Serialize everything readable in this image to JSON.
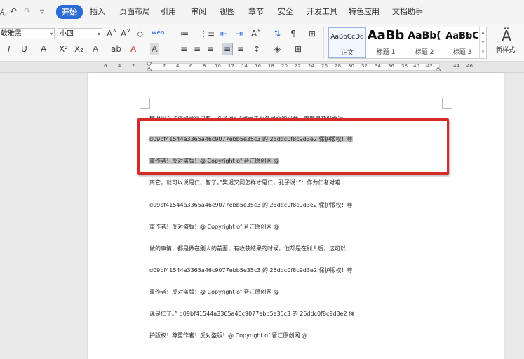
{
  "quick_access": {
    "undo": "↶",
    "redo": "↷",
    "menu": "▿",
    "left_glyph": "ん"
  },
  "tabs": [
    {
      "label": "开始",
      "active": true
    },
    {
      "label": "插入"
    },
    {
      "label": "页面布局"
    },
    {
      "label": "引用"
    },
    {
      "label": "审阅"
    },
    {
      "label": "视图"
    },
    {
      "label": "章节"
    },
    {
      "label": "安全"
    },
    {
      "label": "开发工具"
    },
    {
      "label": "特色应用"
    },
    {
      "label": "文档助手"
    }
  ],
  "font": {
    "name": "软雅黑",
    "size": "小四"
  },
  "toolbar": {
    "grow": "A˄",
    "shrink": "A˅",
    "clear": "◇",
    "phonetic": "wén",
    "italic": "I",
    "underline": "U",
    "strike": "A",
    "superscript": "X²",
    "subscript": "X₂",
    "text_effect": "A",
    "highlight": "ab",
    "font_color": "A",
    "char_shade": "A",
    "bullets": "≔",
    "numbering": "⋮≡",
    "outdent": "⇤",
    "indent": "⇥",
    "case": "Aˇ",
    "sort": "⇅",
    "marks": "¶",
    "border": "⊞",
    "align_left": "≡",
    "align_center": "≡",
    "align_right": "≡",
    "justify": "≡",
    "distribute": "≡",
    "line_spacing": "↕",
    "shading": "◈",
    "borders": "⊞"
  },
  "styles": [
    {
      "preview": "AaBbCcDd",
      "label": "正文",
      "selected": true
    },
    {
      "preview": "AaBb",
      "label": "标题 1"
    },
    {
      "preview": "AaBb(",
      "label": "标题 2"
    },
    {
      "preview": "AaBbC",
      "label": "标题 3"
    }
  ],
  "new_style": {
    "icon": "Ä",
    "label": "新样式·"
  },
  "ruler": {
    "labels_left": [
      "6",
      "4",
      "2"
    ],
    "labels_right": [
      "2",
      "4",
      "6",
      "8",
      "10",
      "12",
      "14",
      "16",
      "18",
      "20",
      "22",
      "24",
      "26",
      "28",
      "30",
      "32",
      "34",
      "36",
      "38",
      "40",
      "42",
      "44",
      "46"
    ]
  },
  "document": {
    "lines": [
      "樊迟问孔子怎样才算是智，孔子说：“致力于服务民众的义举，尊敬鬼神但要远",
      "d09bf41544a3365a46c9077ebb5e35c3 的 25ddc0f8c9d3e2  保护版权！尊",
      "重作者！反对盗版！@ Copyright of  晋江原创网  @",
      "离它，就可以说是仁、智了。”樊迟又问怎样才是仁，孔子说：”：作为仁者对难",
      "d09bf41544a3365a46c9077ebb5e35c3 的 25ddc0f8c9d3e2  保护版权！尊",
      "重作者！反对盗版！@ Copyright of  晋江原创网  @",
      "做的事情，都是做在别人的前面，有收获结果的时候，他却是在别人后，这可以",
      "d09bf41544a3365a46c9077ebb5e35c3 的 25ddc0f8c9d3e2  保护版权！尊",
      "重作者！反对盗版！@ Copyright of  晋江原创网  @",
      "说是仁了。” d09bf41544a3365a46c9077ebb5e35c3 的 25ddc0f8c9d3e2  保",
      "护版权！尊重作者！反对盗版！@ Copyright of  晋江原创网  @"
    ]
  },
  "colors": {
    "accent": "#2b6bd6",
    "annotation_box": "#d42a2a",
    "selection": "#c7c7c7"
  }
}
